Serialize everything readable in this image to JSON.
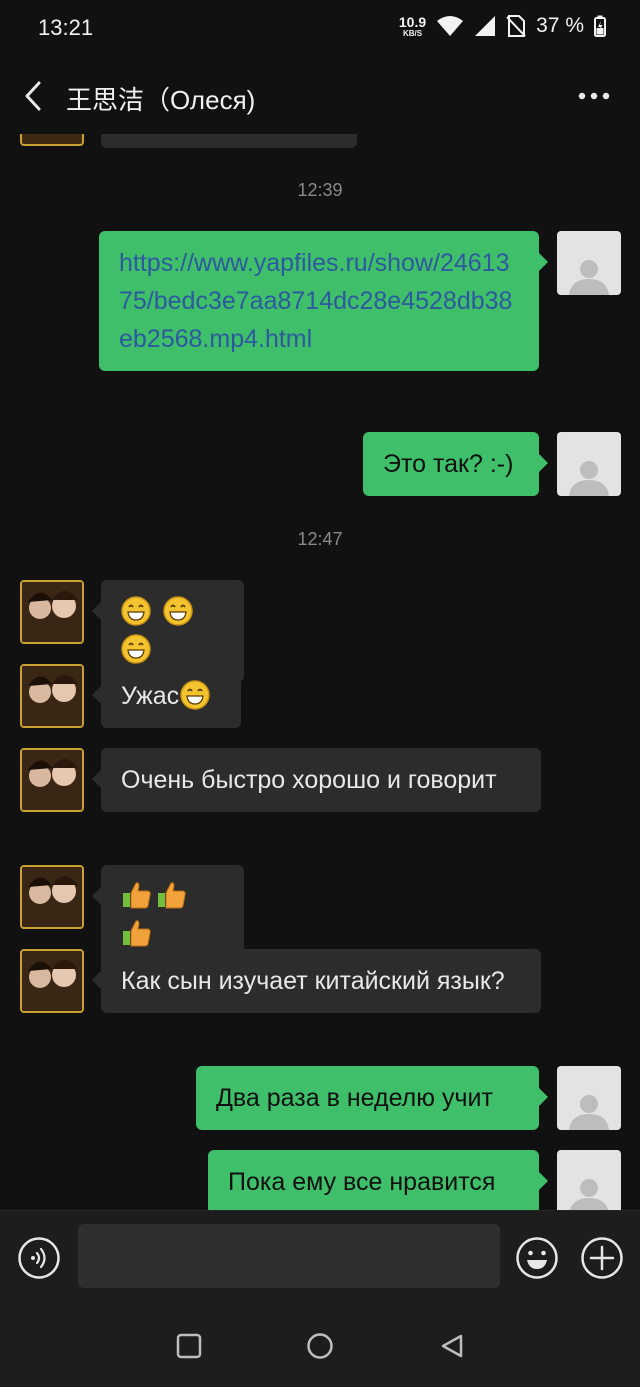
{
  "status_bar": {
    "time": "13:21",
    "net_speed_value": "10.9",
    "net_speed_unit": "KB/S",
    "battery": "37 %",
    "icons": [
      "wifi-icon",
      "signal-icon",
      "no-sim-icon",
      "battery-icon"
    ]
  },
  "header": {
    "title": "王思洁（Олеся)",
    "back_icon": "chevron-left-icon",
    "more_icon": "more-dots-icon"
  },
  "messages": {
    "ts1": "12:39",
    "ts2": "12:47",
    "m1": "https://www.yapfiles.ru/show/2461375/bedc3e7aa8714dc28e4528db38eb2568.mp4.html",
    "m2": "Это так? :-)",
    "m3_emoji": "😁😁😁",
    "m4_text": "Ужас",
    "m4_emoji": "😁",
    "m5": "Очень быстро хорошо и говорит",
    "m6_emoji": "👍👍👍",
    "m7": "Как сын изучает китайский язык?",
    "m8": "Два раза в неделю учит",
    "m9": "Пока ему все нравится"
  },
  "input_bar": {
    "text_value": "",
    "icons": [
      "voice-icon",
      "emoji-icon",
      "plus-icon"
    ]
  },
  "nav_bar": {
    "icons": [
      "recents-square-icon",
      "home-circle-icon",
      "back-triangle-icon"
    ]
  },
  "colors": {
    "background": "#111111",
    "incoming_bubble": "#2c2c2c",
    "outgoing_bubble": "#3fbf6a",
    "link": "#2d5a9e",
    "timestamp": "#8a8a8a"
  }
}
